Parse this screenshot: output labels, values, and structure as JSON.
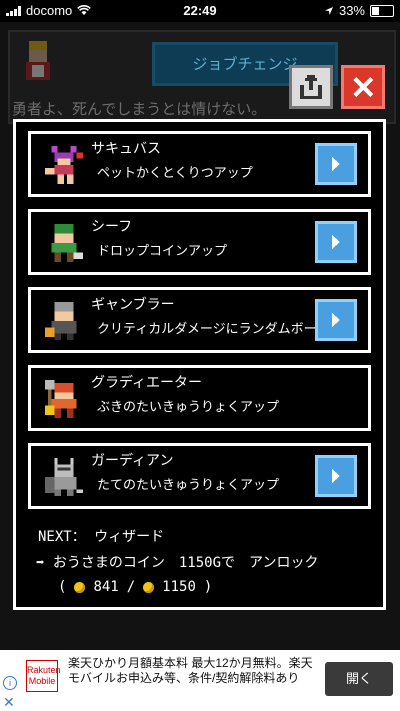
{
  "status_bar": {
    "carrier": "docomo",
    "time": "22:49",
    "battery": "33%"
  },
  "background": {
    "job_change_button": "ジョブチェンジ",
    "message": "勇者よ、死んでしまうとは情けない。"
  },
  "jobs": [
    {
      "name": "サキュバス",
      "desc": "ペットかくとくりつアップ"
    },
    {
      "name": "シーフ",
      "desc": "ドロップコインアップ"
    },
    {
      "name": "ギャンブラー",
      "desc": "クリティカルダメージにランダムボーナス"
    },
    {
      "name": "グラディエーター",
      "desc": "ぶきのたいきゅうりょくアップ"
    },
    {
      "name": "ガーディアン",
      "desc": "たてのたいきゅうりょくアップ"
    }
  ],
  "next": {
    "label": "NEXT：",
    "job": "ウィザード"
  },
  "unlock": {
    "text": "➡ おうさまのコイン　1150Gで　アンロック"
  },
  "coins": {
    "open": "(",
    "have": "841",
    "sep": "/",
    "need": "1150",
    "close": ")"
  },
  "ad": {
    "brand": "Rakuten Mobile",
    "text": "楽天ひかり月額基本料 最大12か月無料。楽天モバイルお申込み等、条件/契約解除料あり",
    "button": "開く"
  },
  "colors": {
    "accent": "#4a9fe0",
    "close": "#d9382b",
    "coin": "#f0c419"
  },
  "icons": [
    "share-icon",
    "close-icon",
    "play-icon",
    "coin-icon"
  ]
}
